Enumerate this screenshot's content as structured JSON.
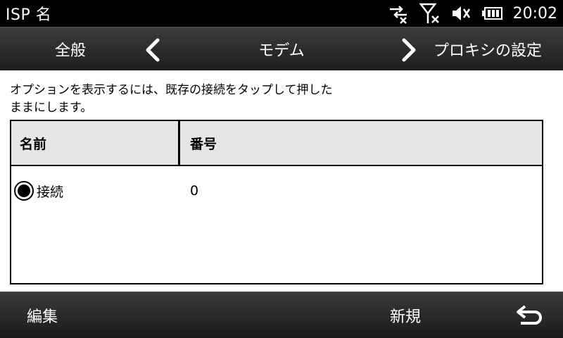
{
  "status": {
    "title": "ISP 名",
    "time": "20:02",
    "icons": [
      "data-sync-icon",
      "signal-off-icon",
      "speaker-muted-icon",
      "battery-icon"
    ]
  },
  "tabs": {
    "previous": "全般",
    "current": "モデム",
    "next": "プロキシの設定"
  },
  "instruction": "オプションを表示するには、既存の接続をタップして押したままにします。",
  "table": {
    "columns": [
      "名前",
      "番号"
    ],
    "rows": [
      {
        "name": "接続",
        "number": "0",
        "selected": true
      }
    ]
  },
  "softkeys": {
    "left": "編集",
    "right": "新規"
  }
}
